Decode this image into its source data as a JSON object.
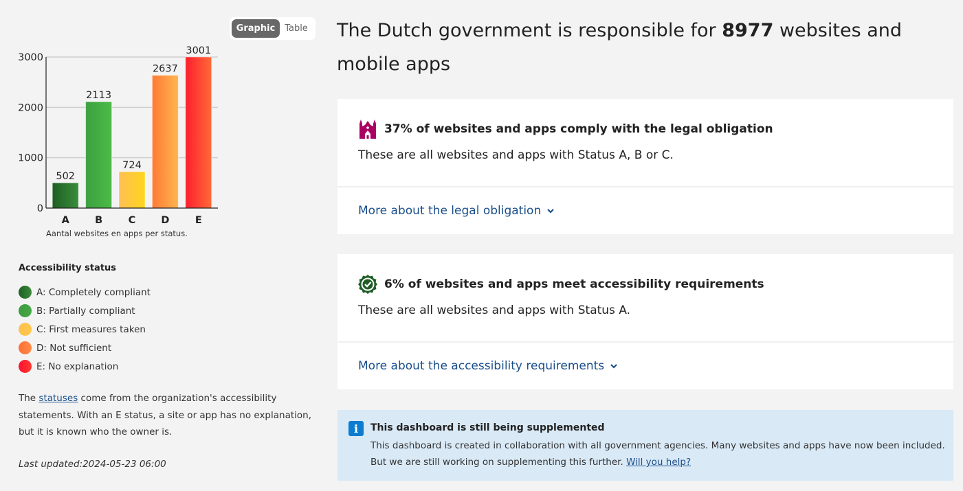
{
  "view_toggle": {
    "options": [
      "Graphic",
      "Table"
    ],
    "selected": "Graphic"
  },
  "chart_data": {
    "type": "bar",
    "categories": [
      "A",
      "B",
      "C",
      "D",
      "E"
    ],
    "values": [
      502,
      2113,
      724,
      2637,
      3001
    ],
    "data_labels": [
      "502",
      "2113",
      "724",
      "2637",
      "3001"
    ],
    "colors": [
      [
        "#1e5f22",
        "#3a8d3c"
      ],
      [
        "#3ca040",
        "#4cbb47"
      ],
      [
        "#ffbf55",
        "#ffd51c"
      ],
      [
        "#ff7a35",
        "#ffb550"
      ],
      [
        "#ff1e2e",
        "#ff6a38"
      ]
    ],
    "title": "",
    "xlabel": "Aantal websites en apps per status.",
    "ylabel": "",
    "ylim": [
      0,
      3000
    ],
    "yticks": [
      0,
      1000,
      2000,
      3000
    ],
    "grid": true,
    "legend": "none"
  },
  "legend": {
    "title": "Accessibility status",
    "items": [
      {
        "label": "A: Completely compliant",
        "color": "#1f6024",
        "color2": "#3a8a3c"
      },
      {
        "label": "B: Partially compliant",
        "color": "#3e9a3f",
        "color2": "#45a944"
      },
      {
        "label": "C: First measures taken",
        "color": "#ffc04e",
        "color2": "#ffc84a"
      },
      {
        "label": "D: Not sufficient",
        "color": "#ff6d38",
        "color2": "#ff8c45"
      },
      {
        "label": "E: No explanation",
        "color": "#ff1030",
        "color2": "#ff3a30"
      }
    ]
  },
  "note": {
    "prefix": "The ",
    "link": "statuses",
    "suffix": " come from the organization's accessibility statements. With an E status, a site or app has no explanation, but it is known who the owner is."
  },
  "last_updated": "Last updated:2024-05-23 06:00",
  "headline": {
    "prefix": "The Dutch government is responsible for ",
    "count": "8977",
    "suffix": " websites and mobile apps"
  },
  "cards": [
    {
      "icon": "government-building-icon",
      "title": "37% of websites and apps comply with the legal obligation",
      "description": "These are all websites and apps with Status A, B or C.",
      "more": "More about the legal obligation"
    },
    {
      "icon": "check-badge-icon",
      "title": "6% of websites and apps meet accessibility requirements",
      "description": "These are all websites and apps with Status A.",
      "more": "More about the accessibility requirements"
    }
  ],
  "info": {
    "title": "This dashboard is still being supplemented",
    "body": "This dashboard is created in collaboration with all government agencies. Many websites and apps have now been included. But we are still working on supplementing this further. ",
    "link": "Will you help?"
  },
  "colors": {
    "link": "#1a4f8a",
    "building_icon": "#a90061",
    "badge_icon": "#1f5c25",
    "info_bg": "#d9e9f6",
    "info_icon": "#0b7cd0",
    "toggle_active": "#686868"
  }
}
